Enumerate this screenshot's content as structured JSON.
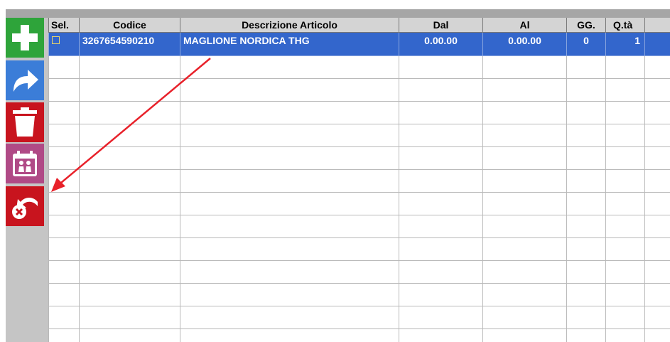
{
  "toolbar": {
    "buttons": [
      {
        "icon": "plus-icon",
        "color": "#2ea43a"
      },
      {
        "icon": "forward-arrow-icon",
        "color": "#3b7dd8"
      },
      {
        "icon": "trash-icon",
        "color": "#c8141e"
      },
      {
        "icon": "calendar-people-icon",
        "color": "#b04a86"
      },
      {
        "icon": "undo-cancel-icon",
        "color": "#c8141e"
      }
    ]
  },
  "grid": {
    "columns": [
      "Sel.",
      "Codice",
      "Descrizione Articolo",
      "Dal",
      "Al",
      "GG.",
      "Q.tà"
    ],
    "rows": [
      {
        "codice": "3267654590210",
        "descrizione": "MAGLIONE NORDICA THG",
        "dal": "0.00.00",
        "al": "0.00.00",
        "gg": "0",
        "qta": "1"
      }
    ],
    "selected_color": "#3366cc"
  },
  "annotation": {
    "arrow_color": "#e8212a"
  }
}
